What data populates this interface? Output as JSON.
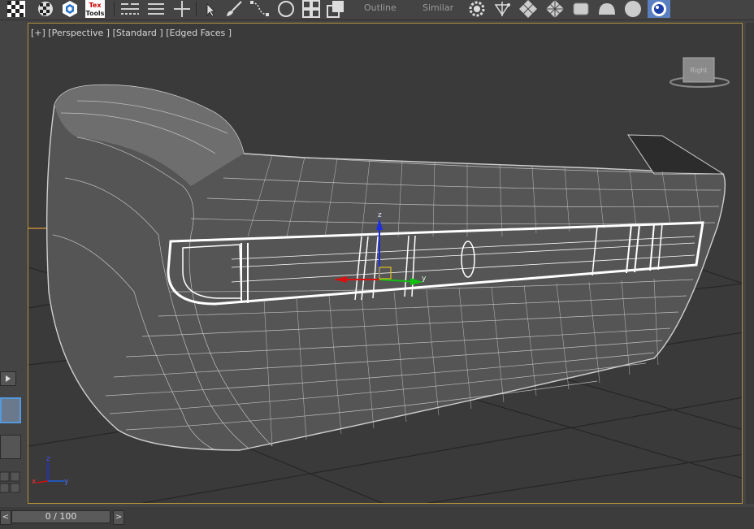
{
  "toolbar": {
    "outline_label": "Outline",
    "similar_label": "Similar",
    "texttools_line1": "Tex",
    "texttools_line2": "Tools",
    "icons": [
      "checker-icon",
      "checker-small-icon",
      "hexagon-logo-icon",
      "textools-icon",
      "list-lines-icon",
      "list-bars-icon",
      "plus-icon",
      "select-arrow-icon",
      "paint-brush-icon",
      "lasso-icon",
      "circle-select-icon",
      "grid-icon",
      "overlap-icon",
      "settings-gear-icon",
      "split-icon",
      "diamond-grid-icon",
      "diamond-grid-2-icon",
      "box-icon",
      "dome-icon",
      "sphere-icon",
      "globe-icon"
    ]
  },
  "viewport": {
    "label": "[+] [Perspective ] [Standard ] [Edged Faces ]",
    "gizmo_labels": {
      "z": "z",
      "y": "y",
      "x": "x"
    },
    "corner_axes": {
      "x": "x",
      "y": "y",
      "z": "z"
    },
    "viewcube_label": "Right",
    "colors": {
      "border": "#b3913a",
      "background": "#3a3a3a",
      "wire": "#d9d9d9",
      "gizmo_x": "#d01010",
      "gizmo_y": "#10c010",
      "gizmo_z": "#1020e0"
    }
  },
  "timeline": {
    "prev_label": "<",
    "next_label": ">",
    "frame_text": "0 / 100"
  }
}
